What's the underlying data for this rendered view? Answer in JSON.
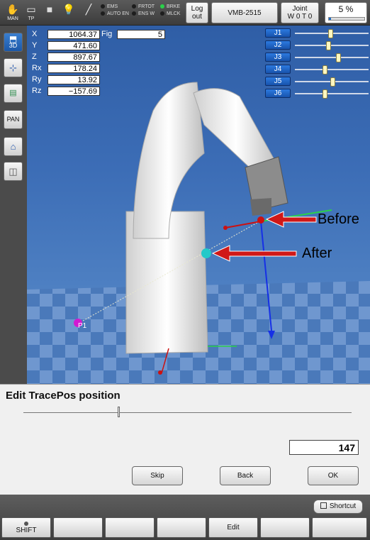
{
  "topbar": {
    "mode_icons": [
      {
        "icon": "hand-icon",
        "label": "MAN"
      },
      {
        "icon": "teach-pendant-icon",
        "label": "TP"
      },
      {
        "icon": "stop-square-icon",
        "label": ""
      },
      {
        "icon": "lightbulb-icon",
        "label": ""
      },
      {
        "icon": "wrench-icon",
        "label": ""
      }
    ],
    "status": [
      {
        "label": "EMS",
        "on": false
      },
      {
        "label": "AUTO EN",
        "on": false
      },
      {
        "label": "FRTOT",
        "on": false
      },
      {
        "label": "ENS W",
        "on": false
      },
      {
        "label": "BRKE",
        "on": true
      },
      {
        "label": "MLCK",
        "on": false
      }
    ],
    "logout_label": "Log out",
    "robot_label": "VMB-2515",
    "joint_label": "Joint",
    "joint_sub": "W 0 T 0",
    "speed_text": "5 %",
    "speed_fraction": 0.05
  },
  "sidebar": [
    {
      "name": "3d-view-button",
      "icon": "cube-3d-icon",
      "label": "3D",
      "active": true
    },
    {
      "name": "pose-button",
      "icon": "pose-icon",
      "label": "",
      "active": false
    },
    {
      "name": "layer-button",
      "icon": "layer-icon",
      "label": "",
      "active": false
    },
    {
      "name": "pan-button",
      "icon": "pan-icon",
      "label": "PAN",
      "active": false
    },
    {
      "name": "home-view-button",
      "icon": "home-icon",
      "label": "",
      "active": false
    },
    {
      "name": "box-view-button",
      "icon": "box-icon",
      "label": "",
      "active": false
    }
  ],
  "coords": [
    {
      "label": "X",
      "value": "1064.37"
    },
    {
      "label": "Y",
      "value": "471.60"
    },
    {
      "label": "Z",
      "value": "897.67"
    },
    {
      "label": "Rx",
      "value": "178.24"
    },
    {
      "label": "Ry",
      "value": "13.92"
    },
    {
      "label": "Rz",
      "value": "−157.69"
    }
  ],
  "fig": {
    "label": "Fig",
    "value": "5"
  },
  "joints": [
    {
      "label": "J1",
      "fraction": 0.48
    },
    {
      "label": "J2",
      "fraction": 0.45
    },
    {
      "label": "J3",
      "fraction": 0.6
    },
    {
      "label": "J4",
      "fraction": 0.4
    },
    {
      "label": "J5",
      "fraction": 0.52
    },
    {
      "label": "J6",
      "fraction": 0.4
    }
  ],
  "viewport": {
    "before_label": "Before",
    "after_label": "After",
    "point_label": "P1",
    "colors": {
      "marker_red": "#cc1111",
      "marker_cyan": "#22c9c9",
      "marker_magenta": "#d21ad2",
      "axis_blue": "#1630e6",
      "axis_green": "#2ad14a",
      "arrow_red": "#d01818"
    }
  },
  "panel": {
    "title": "Edit TracePos position",
    "slider_fraction": 0.29,
    "value": "147",
    "skip_label": "Skip",
    "back_label": "Back",
    "ok_label": "OK"
  },
  "bottom": {
    "shortcut_label": "Shortcut",
    "fkeys": [
      "SHIFT",
      "",
      "",
      "",
      "Edit",
      "",
      ""
    ]
  }
}
